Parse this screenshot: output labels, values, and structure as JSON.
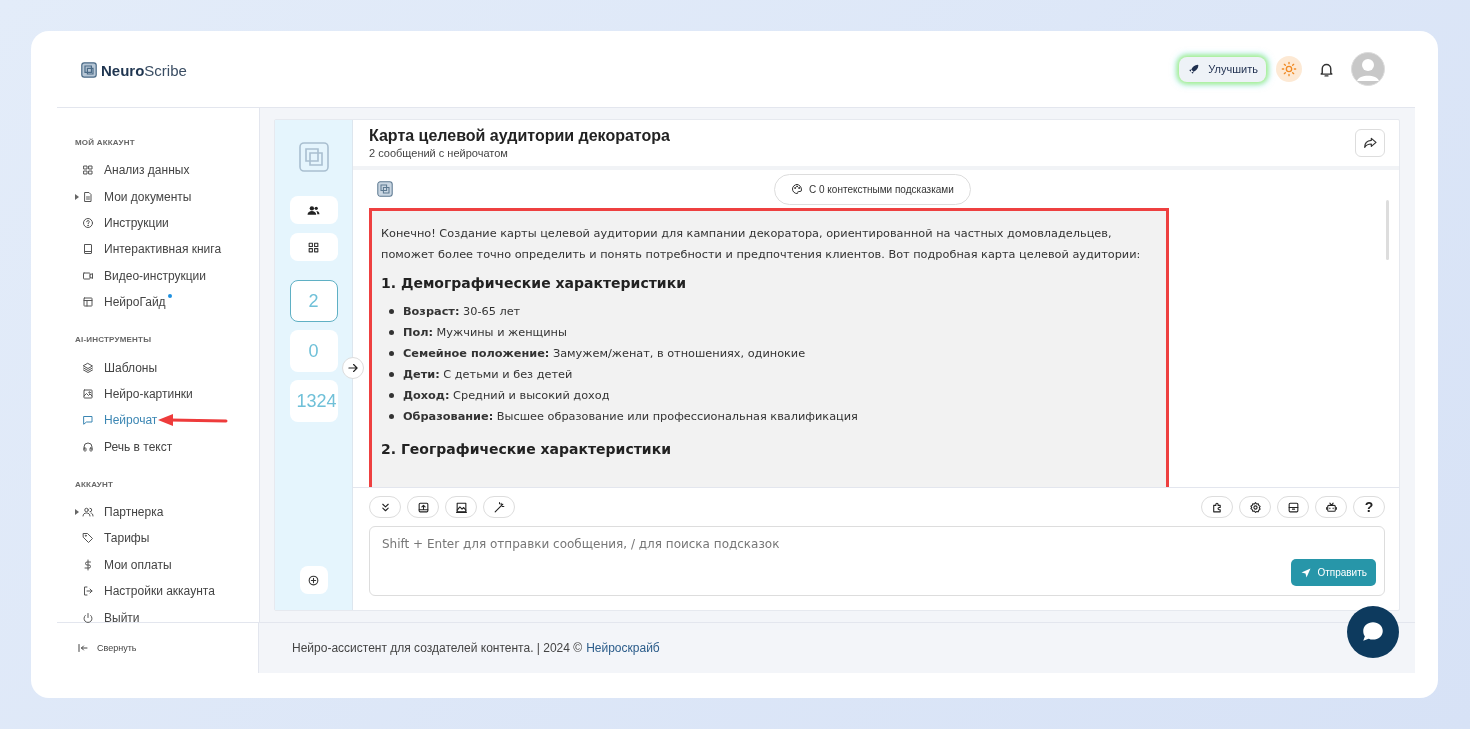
{
  "brand": {
    "bold": "Neuro",
    "rest": "Scribe"
  },
  "topbar": {
    "upgrade_button": "Улучшить"
  },
  "sidebar": {
    "sections": [
      {
        "heading": "МОЙ АККАУНТ",
        "items": [
          {
            "label": "Анализ данных",
            "expandable": false,
            "selected": false,
            "new": false,
            "pointed": false
          },
          {
            "label": "Мои документы",
            "expandable": true,
            "selected": false,
            "new": false,
            "pointed": false
          },
          {
            "label": "Инструкции",
            "expandable": false,
            "selected": false,
            "new": false,
            "pointed": false
          },
          {
            "label": "Интерактивная книга",
            "expandable": false,
            "selected": false,
            "new": false,
            "pointed": false
          },
          {
            "label": "Видео-инструкции",
            "expandable": false,
            "selected": false,
            "new": false,
            "pointed": false
          },
          {
            "label": "НейроГайд",
            "expandable": false,
            "selected": false,
            "new": true,
            "pointed": false
          }
        ]
      },
      {
        "heading": "AI-ИНСТРУМЕНТЫ",
        "items": [
          {
            "label": "Шаблоны",
            "expandable": false,
            "selected": false,
            "new": false,
            "pointed": false
          },
          {
            "label": "Нейро-картинки",
            "expandable": false,
            "selected": false,
            "new": false,
            "pointed": false
          },
          {
            "label": "Нейрочат",
            "expandable": false,
            "selected": true,
            "new": false,
            "pointed": true
          },
          {
            "label": "Речь в текст",
            "expandable": false,
            "selected": false,
            "new": false,
            "pointed": false
          }
        ]
      },
      {
        "heading": "АККАУНТ",
        "items": [
          {
            "label": "Партнерка",
            "expandable": true,
            "selected": false,
            "new": false,
            "pointed": false
          },
          {
            "label": "Тарифы",
            "expandable": false,
            "selected": false,
            "new": false,
            "pointed": false
          },
          {
            "label": "Мои оплаты",
            "expandable": false,
            "selected": false,
            "new": false,
            "pointed": false
          },
          {
            "label": "Настройки аккаунта",
            "expandable": false,
            "selected": false,
            "new": false,
            "pointed": false
          },
          {
            "label": "Выйти",
            "expandable": false,
            "selected": false,
            "new": false,
            "pointed": false
          }
        ]
      }
    ],
    "collapse": "Свернуть"
  },
  "chat_rail": {
    "counters": [
      {
        "value": "2",
        "selected": true
      },
      {
        "value": "0",
        "selected": false
      },
      {
        "value": "1324",
        "selected": false
      }
    ]
  },
  "chat": {
    "title": "Карта целевой аудитории декоратора",
    "subtitle": "2 сообщений с нейрочатом",
    "context_button": "С 0 контекстными подсказками",
    "message": {
      "highlighted": true,
      "intro": "Конечно! Создание карты целевой аудитории для кампании декоратора, ориентированной на частных домовладельцев, поможет более точно определить и понять потребности и предпочтения клиентов. Вот подробная карта целевой аудитории:",
      "sections": [
        {
          "heading": "1. Демографические характеристики",
          "items": [
            "**Возраст:** 30-65 лет",
            "**Пол:** Мужчины и женщины",
            "**Семейное положение:** Замужем/женат, в отношениях, одинокие",
            "**Дети:** С детьми и без детей",
            "**Доход:** Средний и высокий доход",
            "**Образование:** Высшее образование или профессиональная квалификация"
          ]
        },
        {
          "heading": "2. Географические характеристики"
        }
      ]
    },
    "help_button": "?",
    "input": {
      "placeholder": "Shift + Enter для отправки сообщения, / для поиска подсказок"
    },
    "send_button": "Отправить"
  },
  "footer": {
    "text": "Нейро-ассистент для создателей контента.  | 2024 ©",
    "link": "Нейроскрайб"
  }
}
